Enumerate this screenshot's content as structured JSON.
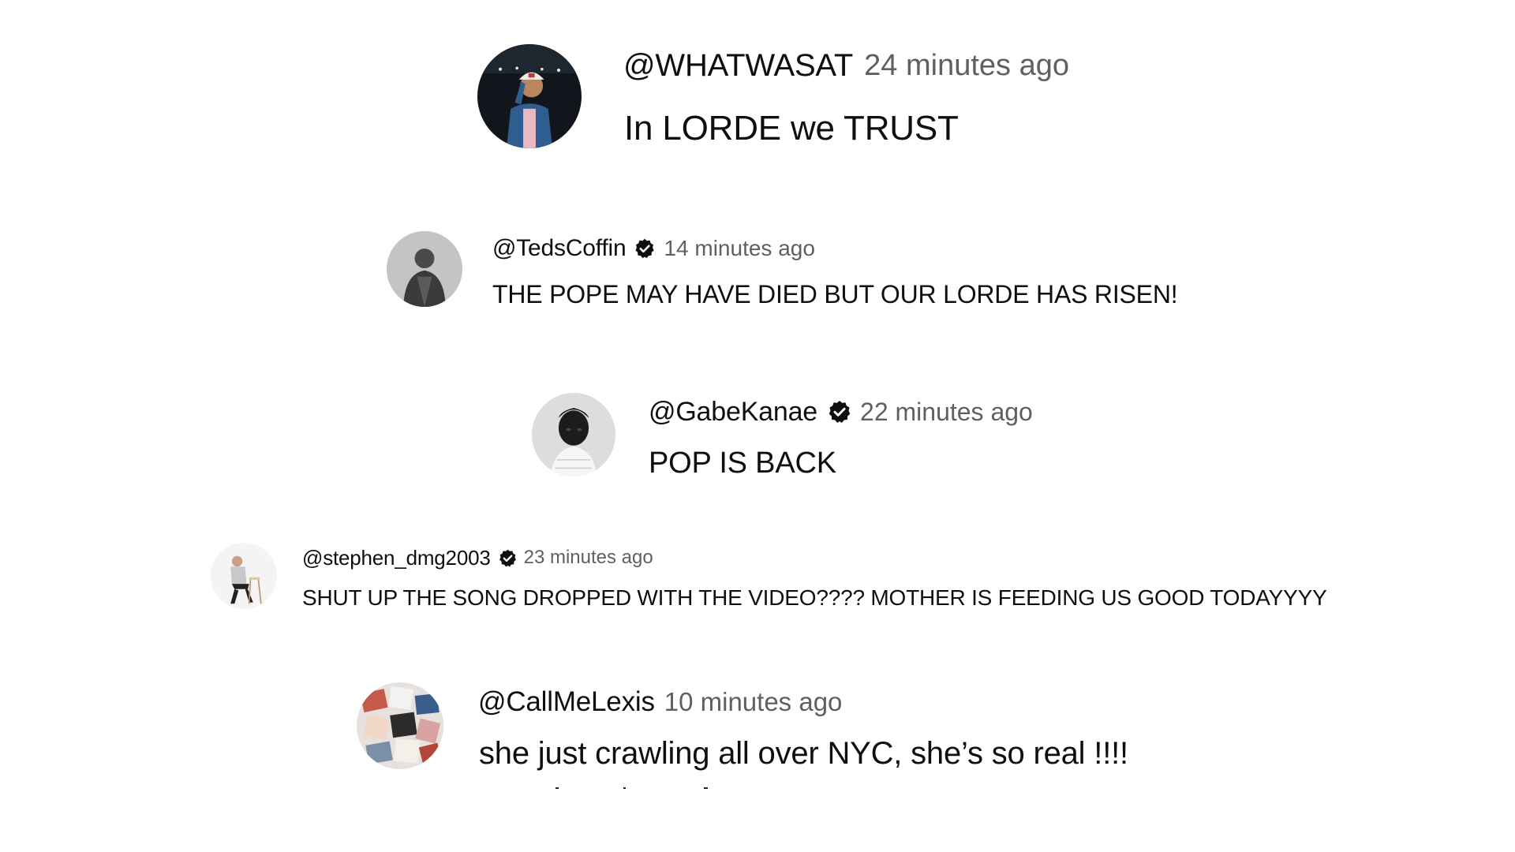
{
  "comments": [
    {
      "handle": "@WHATWASAT",
      "verified": false,
      "timestamp": "24 minutes ago",
      "text": "In LORDE we TRUST",
      "avatar_icon": "avatar-person-cap-icon"
    },
    {
      "handle": "@TedsCoffin",
      "verified": true,
      "timestamp": "14 minutes ago",
      "text": "THE POPE MAY HAVE DIED BUT OUR LORDE HAS RISEN!",
      "avatar_icon": "avatar-person-grey-icon"
    },
    {
      "handle": "@GabeKanae",
      "verified": true,
      "timestamp": "22 minutes ago",
      "text": "POP IS BACK",
      "avatar_icon": "avatar-person-portrait-icon"
    },
    {
      "handle": "@stephen_dmg2003",
      "verified": true,
      "timestamp": "23 minutes ago",
      "text": "SHUT UP THE SONG DROPPED WITH THE VIDEO???? MOTHER IS FEEDING US GOOD TODAYYYY",
      "avatar_icon": "avatar-person-sitting-icon"
    },
    {
      "handle": "@CallMeLexis",
      "verified": false,
      "timestamp": "10 minutes ago",
      "text": "she just crawling all over NYC, she’s so real !!!!",
      "avatar_icon": "avatar-collage-icon"
    }
  ],
  "colors": {
    "text": "#0f0f0f",
    "secondary": "#606060",
    "background": "#ffffff"
  }
}
